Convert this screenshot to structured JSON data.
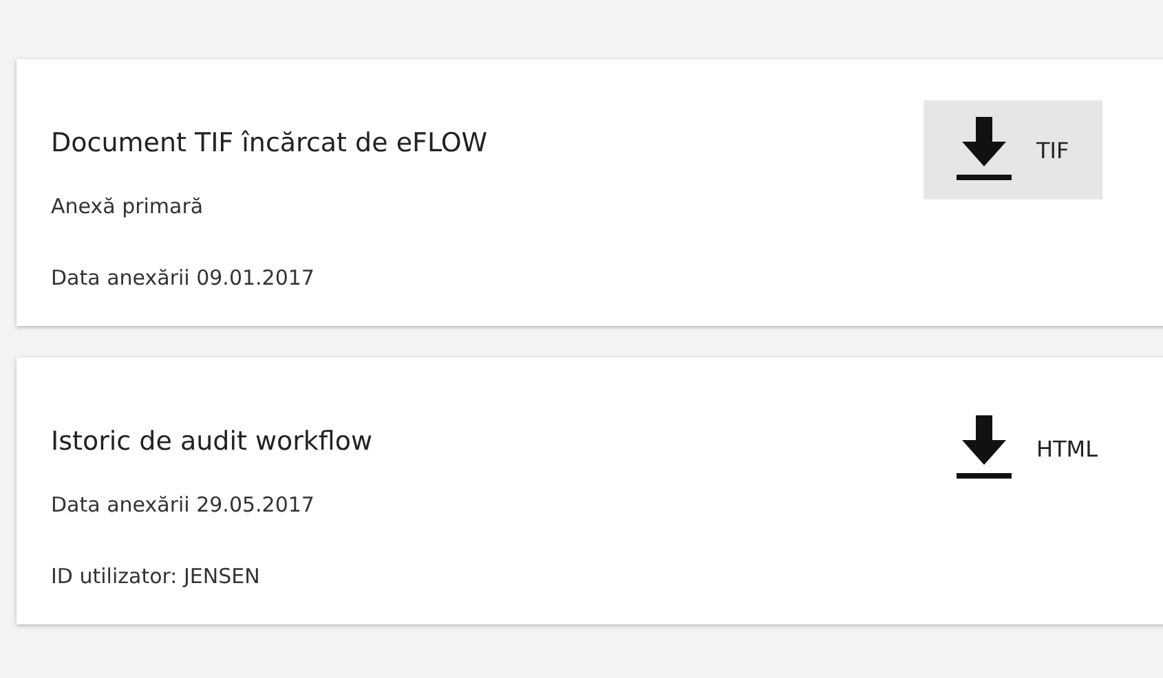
{
  "attachments": [
    {
      "title": "Document TIF încărcat de eFLOW",
      "details": [
        "Anexă primară",
        "Data anexării 09.01.2017"
      ],
      "download": {
        "label": "TIF",
        "highlighted": true
      }
    },
    {
      "title": "Istoric de audit workflow",
      "details": [
        "Data anexării 29.05.2017",
        "ID utilizator: JENSEN"
      ],
      "download": {
        "label": "HTML",
        "highlighted": false
      }
    }
  ]
}
